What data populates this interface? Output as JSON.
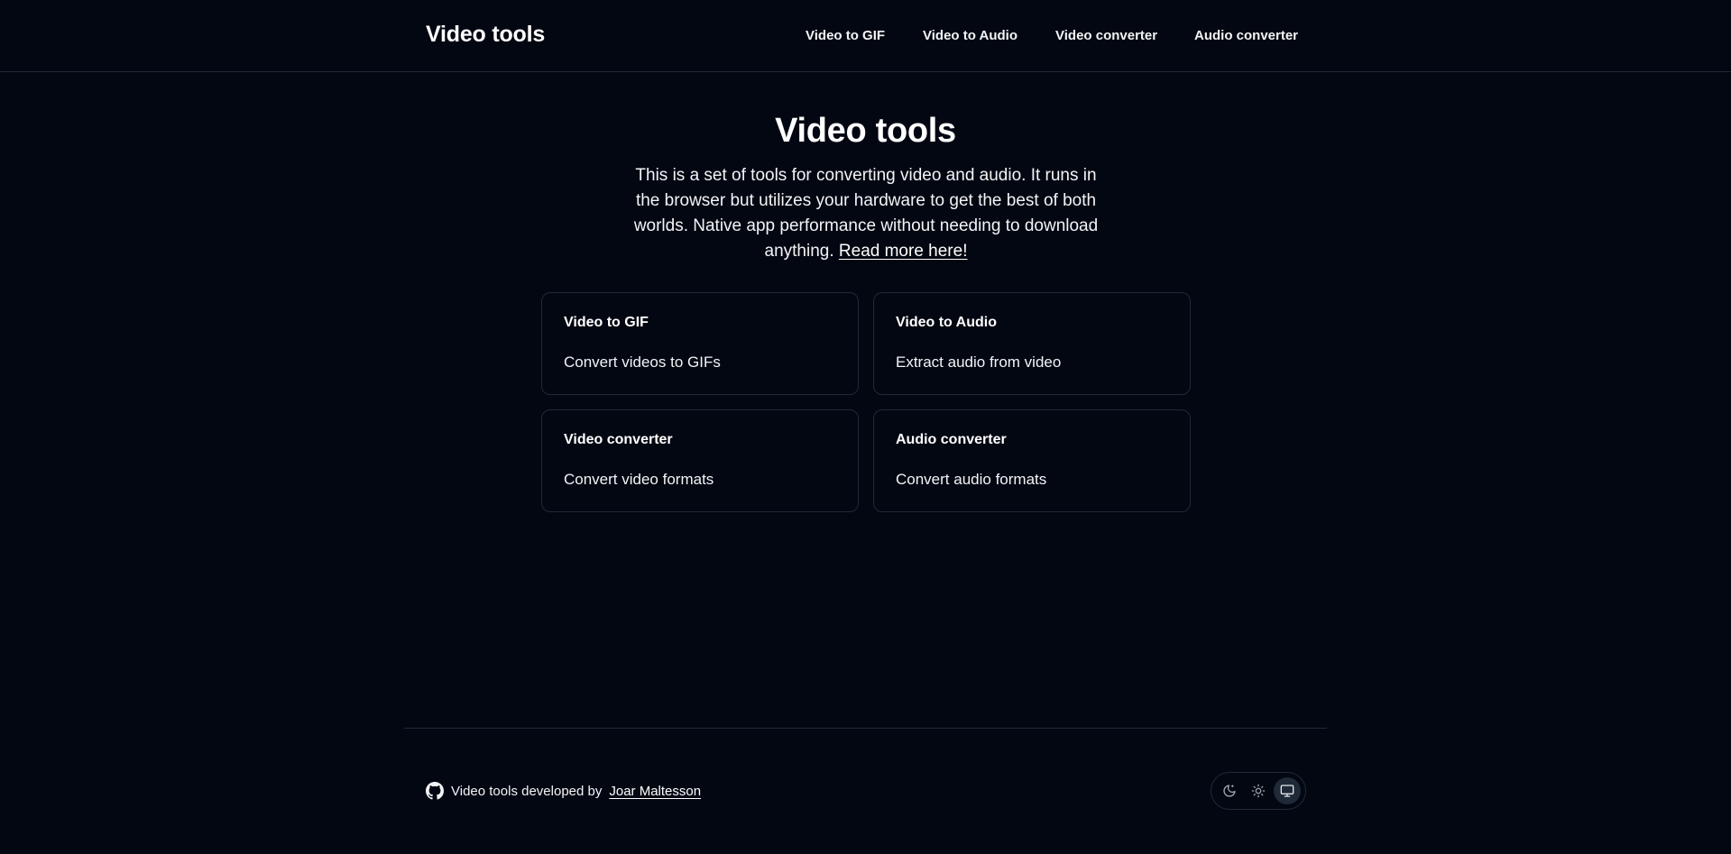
{
  "header": {
    "brand": "Video tools",
    "nav": [
      {
        "label": "Video to GIF"
      },
      {
        "label": "Video to Audio"
      },
      {
        "label": "Video converter"
      },
      {
        "label": "Audio converter"
      }
    ]
  },
  "hero": {
    "title": "Video tools",
    "description": "This is a set of tools for converting video and audio. It runs in the browser but utilizes your hardware to get the best of both worlds. Native app performance without needing to download anything.",
    "link_text": "Read more here!"
  },
  "cards": [
    {
      "title": "Video to GIF",
      "description": "Convert videos to GIFs"
    },
    {
      "title": "Video to Audio",
      "description": "Extract audio from video"
    },
    {
      "title": "Video converter",
      "description": "Convert video formats"
    },
    {
      "title": "Audio converter",
      "description": "Convert audio formats"
    }
  ],
  "footer": {
    "text": "Video tools developed by",
    "author": "Joar Maltesson",
    "github_icon": "github-icon",
    "theme_options": [
      {
        "icon": "moon-icon",
        "active": false
      },
      {
        "icon": "sun-icon",
        "active": false
      },
      {
        "icon": "monitor-icon",
        "active": true
      }
    ]
  },
  "colors": {
    "background": "#030712",
    "border": "#1f2937",
    "text": "#f9fafb"
  }
}
